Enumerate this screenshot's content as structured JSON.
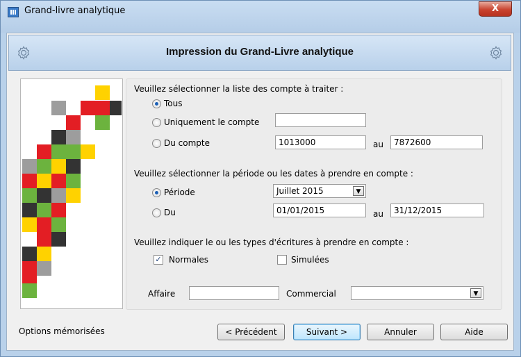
{
  "window": {
    "title": "Grand-livre analytique",
    "close_label": "X"
  },
  "banner": {
    "heading": "Impression du Grand-Livre analytique",
    "left_icon": "gear-icon",
    "right_icon": "gear-icon"
  },
  "accounts": {
    "prompt": "Veuillez sélectionner la liste des compte à traiter :",
    "option_all": "Tous",
    "option_single": "Uniquement le compte",
    "single_value": "",
    "option_range": "Du compte",
    "from_value": "1013000",
    "to_label": "au",
    "to_value": "7872600",
    "selected": "Tous"
  },
  "period": {
    "prompt": "Veuillez sélectionner la période ou les dates à prendre en compte :",
    "option_period": "Période",
    "period_value": "Juillet 2015",
    "option_dates": "Du",
    "from_date": "01/01/2015",
    "to_label": "au",
    "to_date": "31/12/2015",
    "selected": "Période"
  },
  "entries": {
    "prompt": "Veuillez indiquer le ou les types d'écritures à prendre en compte :",
    "normal_label": "Normales",
    "normal_checked": true,
    "simulated_label": "Simulées",
    "simulated_checked": false,
    "check_mark": "✓"
  },
  "filters": {
    "affaire_label": "Affaire",
    "affaire_value": "",
    "commercial_label": "Commercial",
    "commercial_value": ""
  },
  "footer": {
    "options_label": "Options mémorisées",
    "prev_label": "< Précédent",
    "next_label": "Suivant >",
    "cancel_label": "Annuler",
    "help_label": "Aide"
  },
  "colors": {
    "red": "#e31e24",
    "yellow": "#ffd200",
    "green": "#6cb33e",
    "dark": "#333333",
    "grey": "#9d9d9d"
  }
}
